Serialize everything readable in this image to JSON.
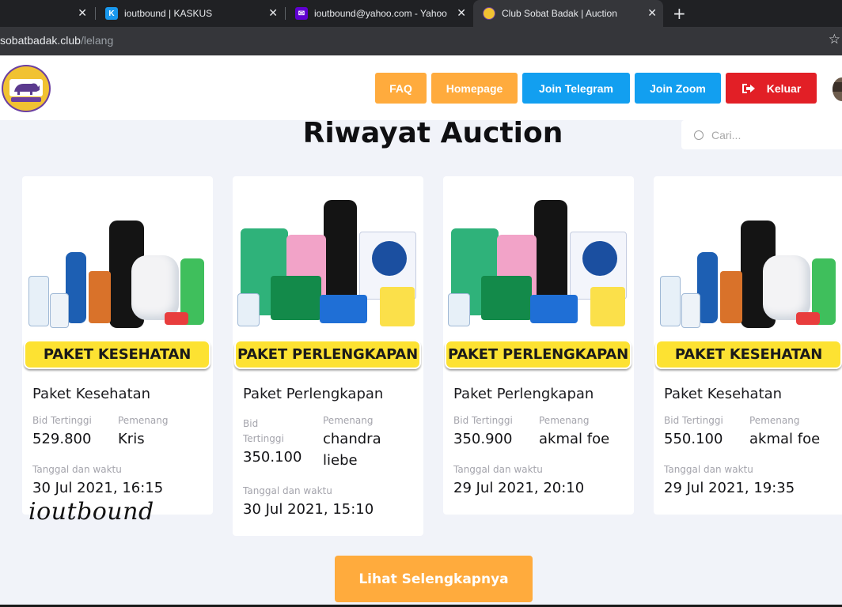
{
  "browser": {
    "tabs": [
      {
        "title": "",
        "close": "✕"
      },
      {
        "title": "ioutbound | KASKUS",
        "close": "✕",
        "favicon_color": "#1998ed"
      },
      {
        "title": "ioutbound@yahoo.com - Yahoo M",
        "close": "✕",
        "favicon_color": "#6001d2"
      },
      {
        "title": "Club Sobat Badak | Auction",
        "close": "✕",
        "favicon_color": "#f1c232"
      }
    ],
    "new_tab": "+",
    "address": {
      "host": "sobatbadak.club",
      "path": "/lelang"
    },
    "star": "☆"
  },
  "header": {
    "logo_icon": "club-sobat-badak-logo",
    "nav": [
      {
        "label": "FAQ",
        "color": "#ffab3d"
      },
      {
        "label": "Homepage",
        "color": "#ffab3d"
      },
      {
        "label": "Join Telegram",
        "color": "#129ff0"
      },
      {
        "label": "Join Zoom",
        "color": "#129ff0"
      },
      {
        "label": "Keluar",
        "color": "#e21f26",
        "icon": "sign-out-icon"
      }
    ]
  },
  "main": {
    "title": "Riwayat Auction",
    "search_placeholder": "Cari...",
    "cards": [
      {
        "banner": "PAKET KESEHATAN",
        "title": "Paket Kesehatan",
        "bid_label": "Bid Tertinggi",
        "bid": "529.800",
        "winner_label": "Pemenang",
        "winner": "Kris",
        "date_label": "Tanggal dan waktu",
        "date": "30 Jul 2021, 16:15"
      },
      {
        "banner": "PAKET PERLENGKAPAN",
        "title": "Paket Perlengkapan",
        "bid_label": "Bid Tertinggi",
        "bid": "350.100",
        "winner_label": "Pemenang",
        "winner": "chandra liebe",
        "date_label": "Tanggal dan waktu",
        "date": "30 Jul 2021, 15:10"
      },
      {
        "banner": "PAKET PERLENGKAPAN",
        "title": "Paket Perlengkapan",
        "bid_label": "Bid Tertinggi",
        "bid": "350.900",
        "winner_label": "Pemenang",
        "winner": "akmal foe",
        "date_label": "Tanggal dan waktu",
        "date": "29 Jul 2021, 20:10"
      },
      {
        "banner": "PAKET KESEHATAN",
        "title": "Paket Kesehatan",
        "bid_label": "Bid Tertinggi",
        "bid": "550.100",
        "winner_label": "Pemenang",
        "winner": "akmal foe",
        "date_label": "Tanggal dan waktu",
        "date": "29 Jul 2021, 19:35"
      }
    ],
    "more_button": "Lihat Selengkapnya"
  },
  "watermark": "ioutbound"
}
